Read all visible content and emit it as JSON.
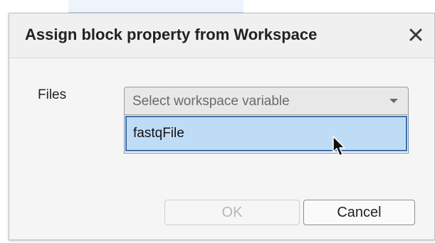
{
  "dialog": {
    "title": "Assign block property from Workspace",
    "close_icon": "close-icon"
  },
  "form": {
    "files_label": "Files",
    "select": {
      "placeholder": "Select workspace variable",
      "state": "open"
    },
    "dropdown": {
      "options": [
        "fastqFile"
      ],
      "highlighted_index": 0
    }
  },
  "buttons": {
    "ok_label": "OK",
    "ok_enabled": false,
    "cancel_label": "Cancel"
  },
  "colors": {
    "highlight": "#bfdcf7",
    "highlight_border": "#3f6fa3",
    "dialog_bg": "#f5f5f5"
  }
}
